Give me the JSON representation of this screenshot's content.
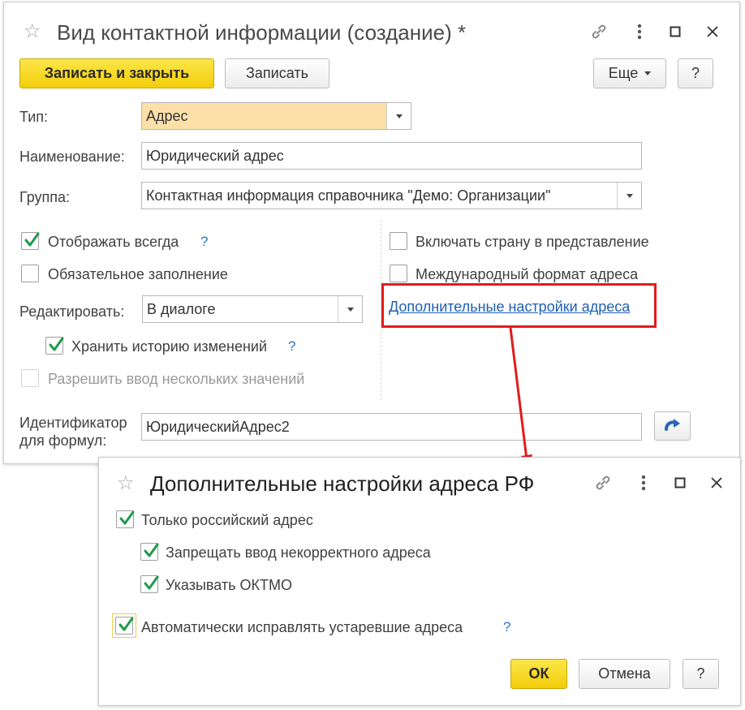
{
  "main_window": {
    "title": "Вид контактной информации (создание) *",
    "toolbar": {
      "save_close_label": "Записать и закрыть",
      "save_label": "Записать",
      "more_label": "Еще",
      "help_label": "?"
    },
    "form": {
      "type_label": "Тип:",
      "type_value": "Адрес",
      "name_label": "Наименование:",
      "name_value": "Юридический адрес",
      "group_label": "Группа:",
      "group_value": "Контактная информация справочника \"Демо: Организации\"",
      "always_show_label": "Отображать всегда",
      "always_show_checked": true,
      "required_label": "Обязательное заполнение",
      "required_checked": false,
      "edit_label": "Редактировать:",
      "edit_value": "В диалоге",
      "keep_history_label": "Хранить историю изменений",
      "keep_history_checked": true,
      "multiple_values_label": "Разрешить ввод нескольких значений",
      "multiple_values_checked": false,
      "include_country_label": "Включать страну в представление",
      "include_country_checked": false,
      "intl_format_label": "Международный формат адреса",
      "intl_format_checked": false,
      "additional_settings_link": "Дополнительные настройки адреса",
      "identifier_label_line1": "Идентификатор",
      "identifier_label_line2": "для формул:",
      "identifier_value": "ЮридическийАдрес2",
      "help_mark": "?"
    }
  },
  "dialog": {
    "title": "Дополнительные настройки адреса РФ",
    "only_russian_label": "Только российский адрес",
    "only_russian_checked": true,
    "forbid_incorrect_label": "Запрещать ввод некорректного адреса",
    "forbid_incorrect_checked": true,
    "oktmo_label": "Указывать ОКТМО",
    "oktmo_checked": true,
    "auto_fix_label": "Автоматически исправлять устаревшие адреса",
    "auto_fix_checked": true,
    "help_mark": "?",
    "ok_label": "ОК",
    "cancel_label": "Отмена",
    "help_label": "?"
  },
  "colors": {
    "accent_yellow": "#f5d313",
    "highlight_red": "#e11b1b",
    "link_blue": "#1f5fb3",
    "check_green": "#1f9a4a"
  }
}
